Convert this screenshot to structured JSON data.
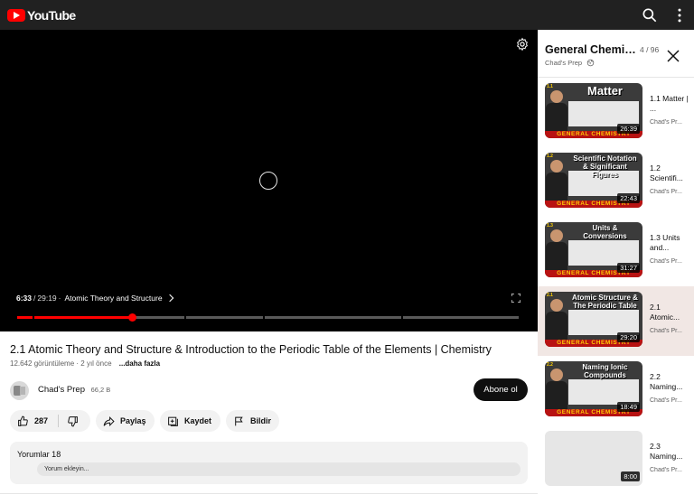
{
  "topbar": {
    "logo_text": "YouTube",
    "icons": [
      "search-icon",
      "more-vert-icon"
    ]
  },
  "player": {
    "current_time": "6:33",
    "separator": "/",
    "total_time": "29:19",
    "chapter_sep": "·",
    "chapter": "Atomic Theory and Structure",
    "progress": 0.229,
    "accent": "#ff0000"
  },
  "video": {
    "title": "2.1 Atomic Theory and Structure & Introduction to the Periodic Table of the Elements | Chemistry",
    "meta": "12.642 görüntüleme · 2 yıl önce",
    "more": "...daha fazla"
  },
  "channel": {
    "name": "Chad's Prep",
    "subs": "66,2 B",
    "subscribe_label": "Abone ol"
  },
  "actions": {
    "likes": "287",
    "share": "Paylaş",
    "save": "Kaydet",
    "report": "Bildir"
  },
  "comments": {
    "title": "Yorumlar 18",
    "placeholder": "Yorum ekleyin..."
  },
  "playlist": {
    "title": "General Chemistry",
    "counter": "4 / 96",
    "channel": "Chad's Prep",
    "items": [
      {
        "thumb_title": "Matter",
        "duration": "26:39",
        "name": "1.1 Matter | ...",
        "channel": "Chad's Pr...",
        "num": "1.1",
        "footer": "GENERAL CHEMISTRY"
      },
      {
        "thumb_title": "Scientific Notation & Significant Figures",
        "duration": "22:43",
        "name": "1.2 Scientifi...",
        "channel": "Chad's Pr...",
        "num": "1.2",
        "footer": "GENERAL CHEMISTRY"
      },
      {
        "thumb_title": "Units & Conversions",
        "duration": "31:27",
        "name": "1.3 Units and...",
        "channel": "Chad's Pr...",
        "num": "1.3",
        "footer": "GENERAL CHEMISTRY"
      },
      {
        "thumb_title": "Atomic Structure & The Periodic Table",
        "duration": "29:20",
        "name": "2.1 Atomic...",
        "channel": "Chad's Pr...",
        "num": "2.1",
        "footer": "GENERAL CHEMISTRY"
      },
      {
        "thumb_title": "Naming Ionic Compounds",
        "duration": "18:49",
        "name": "2.2 Naming...",
        "channel": "Chad's Pr...",
        "num": "2.2",
        "footer": "GENERAL CHEMISTRY"
      },
      {
        "thumb_title": "",
        "duration": "8:00",
        "name": "2.3 Naming...",
        "channel": "Chad's Pr...",
        "num": "",
        "footer": ""
      }
    ]
  }
}
